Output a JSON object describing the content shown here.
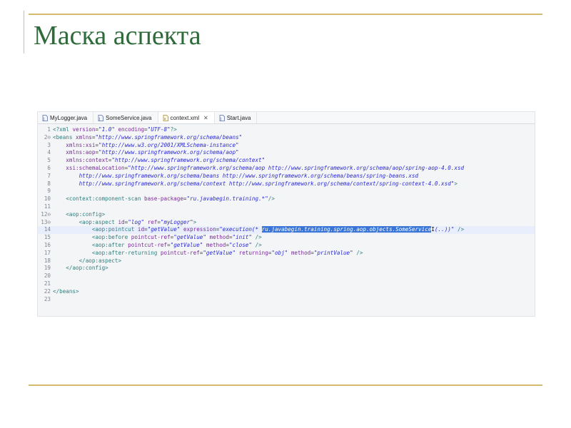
{
  "slide": {
    "title": "Маска аспекта"
  },
  "editor": {
    "tabs": [
      {
        "label": "MyLogger.java",
        "icon": "java-file-icon",
        "active": false,
        "closable": false
      },
      {
        "label": "SomeService.java",
        "icon": "java-file-icon",
        "active": false,
        "closable": false
      },
      {
        "label": "context.xml",
        "icon": "xml-file-icon",
        "active": true,
        "closable": true,
        "close": "✕"
      },
      {
        "label": "Start.java",
        "icon": "java-file-icon",
        "active": false,
        "closable": false
      }
    ],
    "lines": [
      {
        "n": "1",
        "fold": "",
        "segs": [
          [
            "tag",
            "<?xml "
          ],
          [
            "attr",
            "version"
          ],
          [
            "txt",
            "="
          ],
          [
            "val",
            "\"1.0\""
          ],
          [
            "txt",
            " "
          ],
          [
            "attr",
            "encoding"
          ],
          [
            "txt",
            "="
          ],
          [
            "val",
            "\"UTF-8\""
          ],
          [
            "tag",
            "?>"
          ]
        ]
      },
      {
        "n": "2",
        "fold": "⊖",
        "segs": [
          [
            "tag",
            "<beans "
          ],
          [
            "attr",
            "xmlns"
          ],
          [
            "txt",
            "="
          ],
          [
            "val",
            "\"http://www.springframework.org/schema/beans\""
          ]
        ]
      },
      {
        "n": "3",
        "fold": "",
        "segs": [
          [
            "txt",
            "    "
          ],
          [
            "attr",
            "xmlns:xsi"
          ],
          [
            "txt",
            "="
          ],
          [
            "val",
            "\"http://www.w3.org/2001/XMLSchema-instance\""
          ]
        ]
      },
      {
        "n": "4",
        "fold": "",
        "segs": [
          [
            "txt",
            "    "
          ],
          [
            "attr",
            "xmlns:aop"
          ],
          [
            "txt",
            "="
          ],
          [
            "val",
            "\"http://www.springframework.org/schema/aop\""
          ]
        ]
      },
      {
        "n": "5",
        "fold": "",
        "segs": [
          [
            "txt",
            "    "
          ],
          [
            "attr",
            "xmlns:context"
          ],
          [
            "txt",
            "="
          ],
          [
            "val",
            "\"http://www.springframework.org/schema/context\""
          ]
        ]
      },
      {
        "n": "6",
        "fold": "",
        "segs": [
          [
            "txt",
            "    "
          ],
          [
            "attr",
            "xsi:schemaLocation"
          ],
          [
            "txt",
            "="
          ],
          [
            "val",
            "\"http://www.springframework.org/schema/aop http://www.springframework.org/schema/aop/spring-aop-4.0.xsd"
          ]
        ]
      },
      {
        "n": "7",
        "fold": "",
        "segs": [
          [
            "val",
            "        http://www.springframework.org/schema/beans http://www.springframework.org/schema/beans/spring-beans.xsd"
          ]
        ]
      },
      {
        "n": "8",
        "fold": "",
        "segs": [
          [
            "val",
            "        http://www.springframework.org/schema/context http://www.springframework.org/schema/context/spring-context-4.0.xsd\""
          ],
          [
            "tag",
            ">"
          ]
        ]
      },
      {
        "n": "9",
        "fold": "",
        "segs": []
      },
      {
        "n": "10",
        "fold": "",
        "segs": [
          [
            "txt",
            "    "
          ],
          [
            "tag",
            "<context:component-scan "
          ],
          [
            "attr",
            "base-package"
          ],
          [
            "txt",
            "="
          ],
          [
            "val",
            "\"ru.javabegin.training.*\""
          ],
          [
            "tag",
            "/>"
          ]
        ]
      },
      {
        "n": "11",
        "fold": "",
        "segs": []
      },
      {
        "n": "12",
        "fold": "⊖",
        "segs": [
          [
            "txt",
            "    "
          ],
          [
            "tag",
            "<aop:config>"
          ]
        ]
      },
      {
        "n": "13",
        "fold": "⊖",
        "segs": [
          [
            "txt",
            "        "
          ],
          [
            "tag",
            "<aop:aspect "
          ],
          [
            "attr",
            "id"
          ],
          [
            "txt",
            "="
          ],
          [
            "val",
            "\"log\""
          ],
          [
            "txt",
            " "
          ],
          [
            "attr",
            "ref"
          ],
          [
            "txt",
            "="
          ],
          [
            "val",
            "\"myLogger\""
          ],
          [
            "tag",
            ">"
          ]
        ]
      },
      {
        "n": "14",
        "fold": "",
        "current": true,
        "segs": [
          [
            "txt",
            "            "
          ],
          [
            "tag",
            "<aop:pointcut "
          ],
          [
            "attr",
            "id"
          ],
          [
            "txt",
            "="
          ],
          [
            "val",
            "\"getValue\""
          ],
          [
            "txt",
            " "
          ],
          [
            "attr",
            "expression"
          ],
          [
            "txt",
            "="
          ],
          [
            "val",
            "\"execution(* "
          ],
          [
            "sel",
            "ru.javabegin.training.spring.aop.objects.SomeService"
          ],
          [
            "cursor",
            "I"
          ],
          [
            "val",
            "(..))\""
          ],
          [
            "tag",
            " />"
          ]
        ]
      },
      {
        "n": "15",
        "fold": "",
        "segs": [
          [
            "txt",
            "            "
          ],
          [
            "tag",
            "<aop:before "
          ],
          [
            "attr",
            "pointcut-ref"
          ],
          [
            "txt",
            "="
          ],
          [
            "val",
            "\"getValue\""
          ],
          [
            "txt",
            " "
          ],
          [
            "attr",
            "method"
          ],
          [
            "txt",
            "="
          ],
          [
            "val",
            "\"init\""
          ],
          [
            "tag",
            " />"
          ]
        ]
      },
      {
        "n": "16",
        "fold": "",
        "segs": [
          [
            "txt",
            "            "
          ],
          [
            "tag",
            "<aop:after "
          ],
          [
            "attr",
            "pointcut-ref"
          ],
          [
            "txt",
            "="
          ],
          [
            "val",
            "\"getValue\""
          ],
          [
            "txt",
            " "
          ],
          [
            "attr",
            "method"
          ],
          [
            "txt",
            "="
          ],
          [
            "val",
            "\"close\""
          ],
          [
            "tag",
            " />"
          ]
        ]
      },
      {
        "n": "17",
        "fold": "",
        "segs": [
          [
            "txt",
            "            "
          ],
          [
            "tag",
            "<aop:after-returning "
          ],
          [
            "attr",
            "pointcut-ref"
          ],
          [
            "txt",
            "="
          ],
          [
            "val",
            "\"getValue\""
          ],
          [
            "txt",
            " "
          ],
          [
            "attr",
            "returning"
          ],
          [
            "txt",
            "="
          ],
          [
            "val",
            "\"obj\""
          ],
          [
            "txt",
            " "
          ],
          [
            "attr",
            "method"
          ],
          [
            "txt",
            "="
          ],
          [
            "val",
            "\"printValue\""
          ],
          [
            "tag",
            " />"
          ]
        ]
      },
      {
        "n": "18",
        "fold": "",
        "segs": [
          [
            "txt",
            "        "
          ],
          [
            "tag",
            "</aop:aspect>"
          ]
        ]
      },
      {
        "n": "19",
        "fold": "",
        "segs": [
          [
            "txt",
            "    "
          ],
          [
            "tag",
            "</aop:config>"
          ]
        ]
      },
      {
        "n": "20",
        "fold": "",
        "segs": []
      },
      {
        "n": "21",
        "fold": "",
        "segs": []
      },
      {
        "n": "22",
        "fold": "",
        "segs": [
          [
            "tag",
            "</beans>"
          ]
        ]
      },
      {
        "n": "23",
        "fold": "",
        "segs": []
      }
    ]
  },
  "colors": {
    "title": "#2f6b3a",
    "rule": "#d7b96b",
    "selection": "#3875d7"
  }
}
